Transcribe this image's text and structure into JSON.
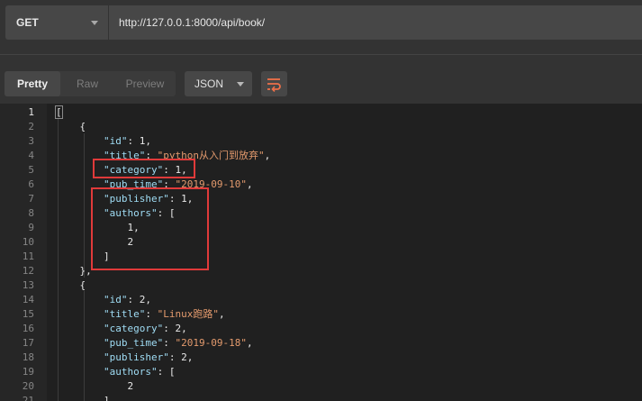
{
  "request": {
    "method": "GET",
    "url": "http://127.0.0.1:8000/api/book/"
  },
  "response_toolbar": {
    "tabs": [
      "Pretty",
      "Raw",
      "Preview"
    ],
    "active_tab": "Pretty",
    "format": "JSON",
    "icons": {
      "wrap": "wrap-lines-icon",
      "method_caret": "chevron-down-icon"
    }
  },
  "colors": {
    "key": "#9fdcf4",
    "string": "#e39a6d",
    "annotation": "#e03a3a"
  },
  "editor": {
    "current_line": 1,
    "lines": [
      {
        "n": "1",
        "indent": "",
        "tokens": [
          {
            "t": "[",
            "c": "punct"
          }
        ]
      },
      {
        "n": "2",
        "indent": "    ",
        "tokens": [
          {
            "t": "{",
            "c": "punct"
          }
        ]
      },
      {
        "n": "3",
        "indent": "        ",
        "tokens": [
          {
            "t": "\"id\"",
            "c": "key"
          },
          {
            "t": ": ",
            "c": "punct"
          },
          {
            "t": "1",
            "c": "num"
          },
          {
            "t": ",",
            "c": "punct"
          }
        ]
      },
      {
        "n": "4",
        "indent": "        ",
        "tokens": [
          {
            "t": "\"title\"",
            "c": "key"
          },
          {
            "t": ": ",
            "c": "punct"
          },
          {
            "t": "\"python从入门到放弃\"",
            "c": "str"
          },
          {
            "t": ",",
            "c": "punct"
          }
        ]
      },
      {
        "n": "5",
        "indent": "        ",
        "tokens": [
          {
            "t": "\"category\"",
            "c": "key"
          },
          {
            "t": ": ",
            "c": "punct"
          },
          {
            "t": "1",
            "c": "num"
          },
          {
            "t": ",",
            "c": "punct"
          }
        ]
      },
      {
        "n": "6",
        "indent": "        ",
        "tokens": [
          {
            "t": "\"pub_time\"",
            "c": "key"
          },
          {
            "t": ": ",
            "c": "punct"
          },
          {
            "t": "\"2019-09-10\"",
            "c": "str"
          },
          {
            "t": ",",
            "c": "punct"
          }
        ]
      },
      {
        "n": "7",
        "indent": "        ",
        "tokens": [
          {
            "t": "\"publisher\"",
            "c": "key"
          },
          {
            "t": ": ",
            "c": "punct"
          },
          {
            "t": "1",
            "c": "num"
          },
          {
            "t": ",",
            "c": "punct"
          }
        ]
      },
      {
        "n": "8",
        "indent": "        ",
        "tokens": [
          {
            "t": "\"authors\"",
            "c": "key"
          },
          {
            "t": ": ",
            "c": "punct"
          },
          {
            "t": "[",
            "c": "punct"
          }
        ]
      },
      {
        "n": "9",
        "indent": "            ",
        "tokens": [
          {
            "t": "1",
            "c": "num"
          },
          {
            "t": ",",
            "c": "punct"
          }
        ]
      },
      {
        "n": "10",
        "indent": "            ",
        "tokens": [
          {
            "t": "2",
            "c": "num"
          }
        ]
      },
      {
        "n": "11",
        "indent": "        ",
        "tokens": [
          {
            "t": "]",
            "c": "punct"
          }
        ]
      },
      {
        "n": "12",
        "indent": "    ",
        "tokens": [
          {
            "t": "},",
            "c": "punct"
          }
        ]
      },
      {
        "n": "13",
        "indent": "    ",
        "tokens": [
          {
            "t": "{",
            "c": "punct"
          }
        ]
      },
      {
        "n": "14",
        "indent": "        ",
        "tokens": [
          {
            "t": "\"id\"",
            "c": "key"
          },
          {
            "t": ": ",
            "c": "punct"
          },
          {
            "t": "2",
            "c": "num"
          },
          {
            "t": ",",
            "c": "punct"
          }
        ]
      },
      {
        "n": "15",
        "indent": "        ",
        "tokens": [
          {
            "t": "\"title\"",
            "c": "key"
          },
          {
            "t": ": ",
            "c": "punct"
          },
          {
            "t": "\"Linux跑路\"",
            "c": "str"
          },
          {
            "t": ",",
            "c": "punct"
          }
        ]
      },
      {
        "n": "16",
        "indent": "        ",
        "tokens": [
          {
            "t": "\"category\"",
            "c": "key"
          },
          {
            "t": ": ",
            "c": "punct"
          },
          {
            "t": "2",
            "c": "num"
          },
          {
            "t": ",",
            "c": "punct"
          }
        ]
      },
      {
        "n": "17",
        "indent": "        ",
        "tokens": [
          {
            "t": "\"pub_time\"",
            "c": "key"
          },
          {
            "t": ": ",
            "c": "punct"
          },
          {
            "t": "\"2019-09-18\"",
            "c": "str"
          },
          {
            "t": ",",
            "c": "punct"
          }
        ]
      },
      {
        "n": "18",
        "indent": "        ",
        "tokens": [
          {
            "t": "\"publisher\"",
            "c": "key"
          },
          {
            "t": ": ",
            "c": "punct"
          },
          {
            "t": "2",
            "c": "num"
          },
          {
            "t": ",",
            "c": "punct"
          }
        ]
      },
      {
        "n": "19",
        "indent": "        ",
        "tokens": [
          {
            "t": "\"authors\"",
            "c": "key"
          },
          {
            "t": ": ",
            "c": "punct"
          },
          {
            "t": "[",
            "c": "punct"
          }
        ]
      },
      {
        "n": "20",
        "indent": "            ",
        "tokens": [
          {
            "t": "2",
            "c": "num"
          }
        ]
      },
      {
        "n": "21",
        "indent": "        ",
        "tokens": [
          {
            "t": "],",
            "c": "punct"
          }
        ]
      }
    ]
  }
}
